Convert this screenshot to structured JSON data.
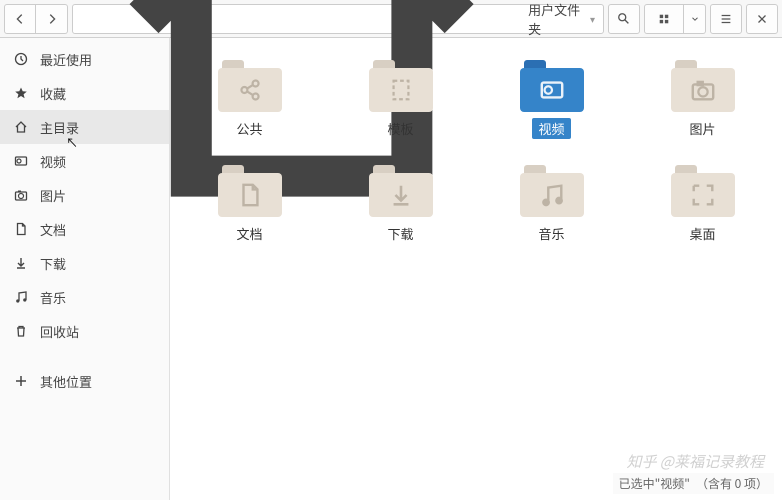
{
  "toolbar": {
    "path_label": "用户文件夹"
  },
  "sidebar": {
    "items": [
      {
        "key": "recent",
        "label": "最近使用",
        "icon": "clock"
      },
      {
        "key": "starred",
        "label": "收藏",
        "icon": "star"
      },
      {
        "key": "home",
        "label": "主目录",
        "icon": "home",
        "selected": true
      },
      {
        "key": "videos",
        "label": "视频",
        "icon": "video"
      },
      {
        "key": "pictures",
        "label": "图片",
        "icon": "camera"
      },
      {
        "key": "documents",
        "label": "文档",
        "icon": "doc"
      },
      {
        "key": "downloads",
        "label": "下载",
        "icon": "down"
      },
      {
        "key": "music",
        "label": "音乐",
        "icon": "music"
      },
      {
        "key": "trash",
        "label": "回收站",
        "icon": "trash"
      }
    ],
    "other": {
      "label": "其他位置",
      "icon": "plus"
    }
  },
  "folders": [
    {
      "label": "公共",
      "icon": "share"
    },
    {
      "label": "模板",
      "icon": "template"
    },
    {
      "label": "视频",
      "icon": "video",
      "selected": true
    },
    {
      "label": "图片",
      "icon": "camera"
    },
    {
      "label": "文档",
      "icon": "doc"
    },
    {
      "label": "下载",
      "icon": "down"
    },
    {
      "label": "音乐",
      "icon": "music"
    },
    {
      "label": "桌面",
      "icon": "desktop"
    }
  ],
  "status": "已选中\"视频\"　（含有 0 项）",
  "watermark": "知乎 @莱福记录教程"
}
